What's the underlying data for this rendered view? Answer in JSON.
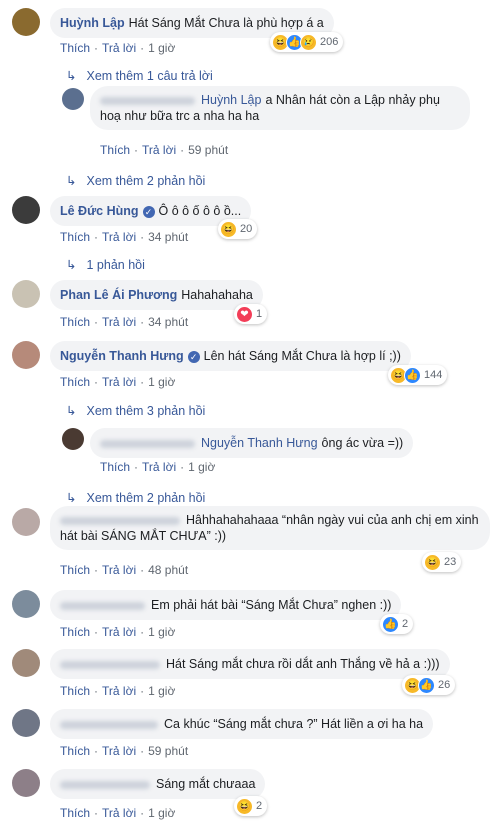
{
  "actions": {
    "like": "Thích",
    "reply": "Trả lời",
    "sep": "·"
  },
  "comments": [
    {
      "author": "Huỳnh Lập",
      "text": "Hát Sáng Mắt Chưa là phù hợp á a",
      "time": "1 giờ",
      "reactions": [
        "haha",
        "like",
        "sad"
      ],
      "count": "206",
      "avatar_color": "#8a6a2f"
    },
    {
      "mention": "Huỳnh Lập",
      "text": "a Nhân hát còn a Lập nhảy phụ hoạ như bữa trc a nha ha ha",
      "time": "59 phút",
      "reactions": [],
      "count": "",
      "avatar_color": "#5b6f8f"
    },
    {
      "author": "Lê Đức Hùng",
      "text": "Ô ô ô ố ô ô ồ...",
      "time": "34 phút",
      "reactions": [
        "haha"
      ],
      "count": "20",
      "avatar_color": "#3b3b3b"
    },
    {
      "author": "Phan Lê Ái Phương",
      "text": "Hahahahaha",
      "time": "34 phút",
      "reactions": [
        "love"
      ],
      "count": "1",
      "avatar_color": "#c9c2b3"
    },
    {
      "author": "Nguyễn Thanh Hưng",
      "text": "Lên hát Sáng Mắt Chưa là hợp lí ;))",
      "time": "1 giờ",
      "reactions": [
        "haha",
        "like"
      ],
      "count": "144",
      "avatar_color": "#b68a7a"
    },
    {
      "mention": "Nguyễn Thanh Hưng",
      "text": "ông ác vừa =))",
      "time": "1 giờ",
      "reactions": [],
      "count": "",
      "avatar_color": "#4a3a32"
    },
    {
      "text": "Hâhhahahahaaa “nhân ngày vui của anh chị em xinh hát bài SÁNG MẮT CHƯA” :))",
      "time": "48 phút",
      "reactions": [
        "haha"
      ],
      "count": "23",
      "avatar_color": "#b9a9a6"
    },
    {
      "text": "Em phải hát bài “Sáng Mắt Chưa” nghen :))",
      "time": "1 giờ",
      "reactions": [
        "like"
      ],
      "count": "2",
      "avatar_color": "#7c8c9c"
    },
    {
      "text": "Hát Sáng mắt chưa rồi dắt anh Thắng về hả a :)))",
      "time": "1 giờ",
      "reactions": [
        "haha",
        "like"
      ],
      "count": "26",
      "avatar_color": "#a08a7a"
    },
    {
      "text": "Ca khúc “Sáng mắt chưa ?” Hát liền a ơi ha ha",
      "time": "59 phút",
      "reactions": [],
      "count": "",
      "avatar_color": "#6f7686"
    },
    {
      "text": "Sáng mắt chưaaa",
      "time": "1 giờ",
      "reactions": [
        "haha"
      ],
      "count": "2",
      "avatar_color": "#8d7f88"
    }
  ],
  "more_links": [
    "Xem thêm 1 câu trả lời",
    "Xem thêm 2 phản hồi",
    "1 phản hồi",
    "Xem thêm 3 phản hồi",
    "Xem thêm 2 phản hồi"
  ]
}
